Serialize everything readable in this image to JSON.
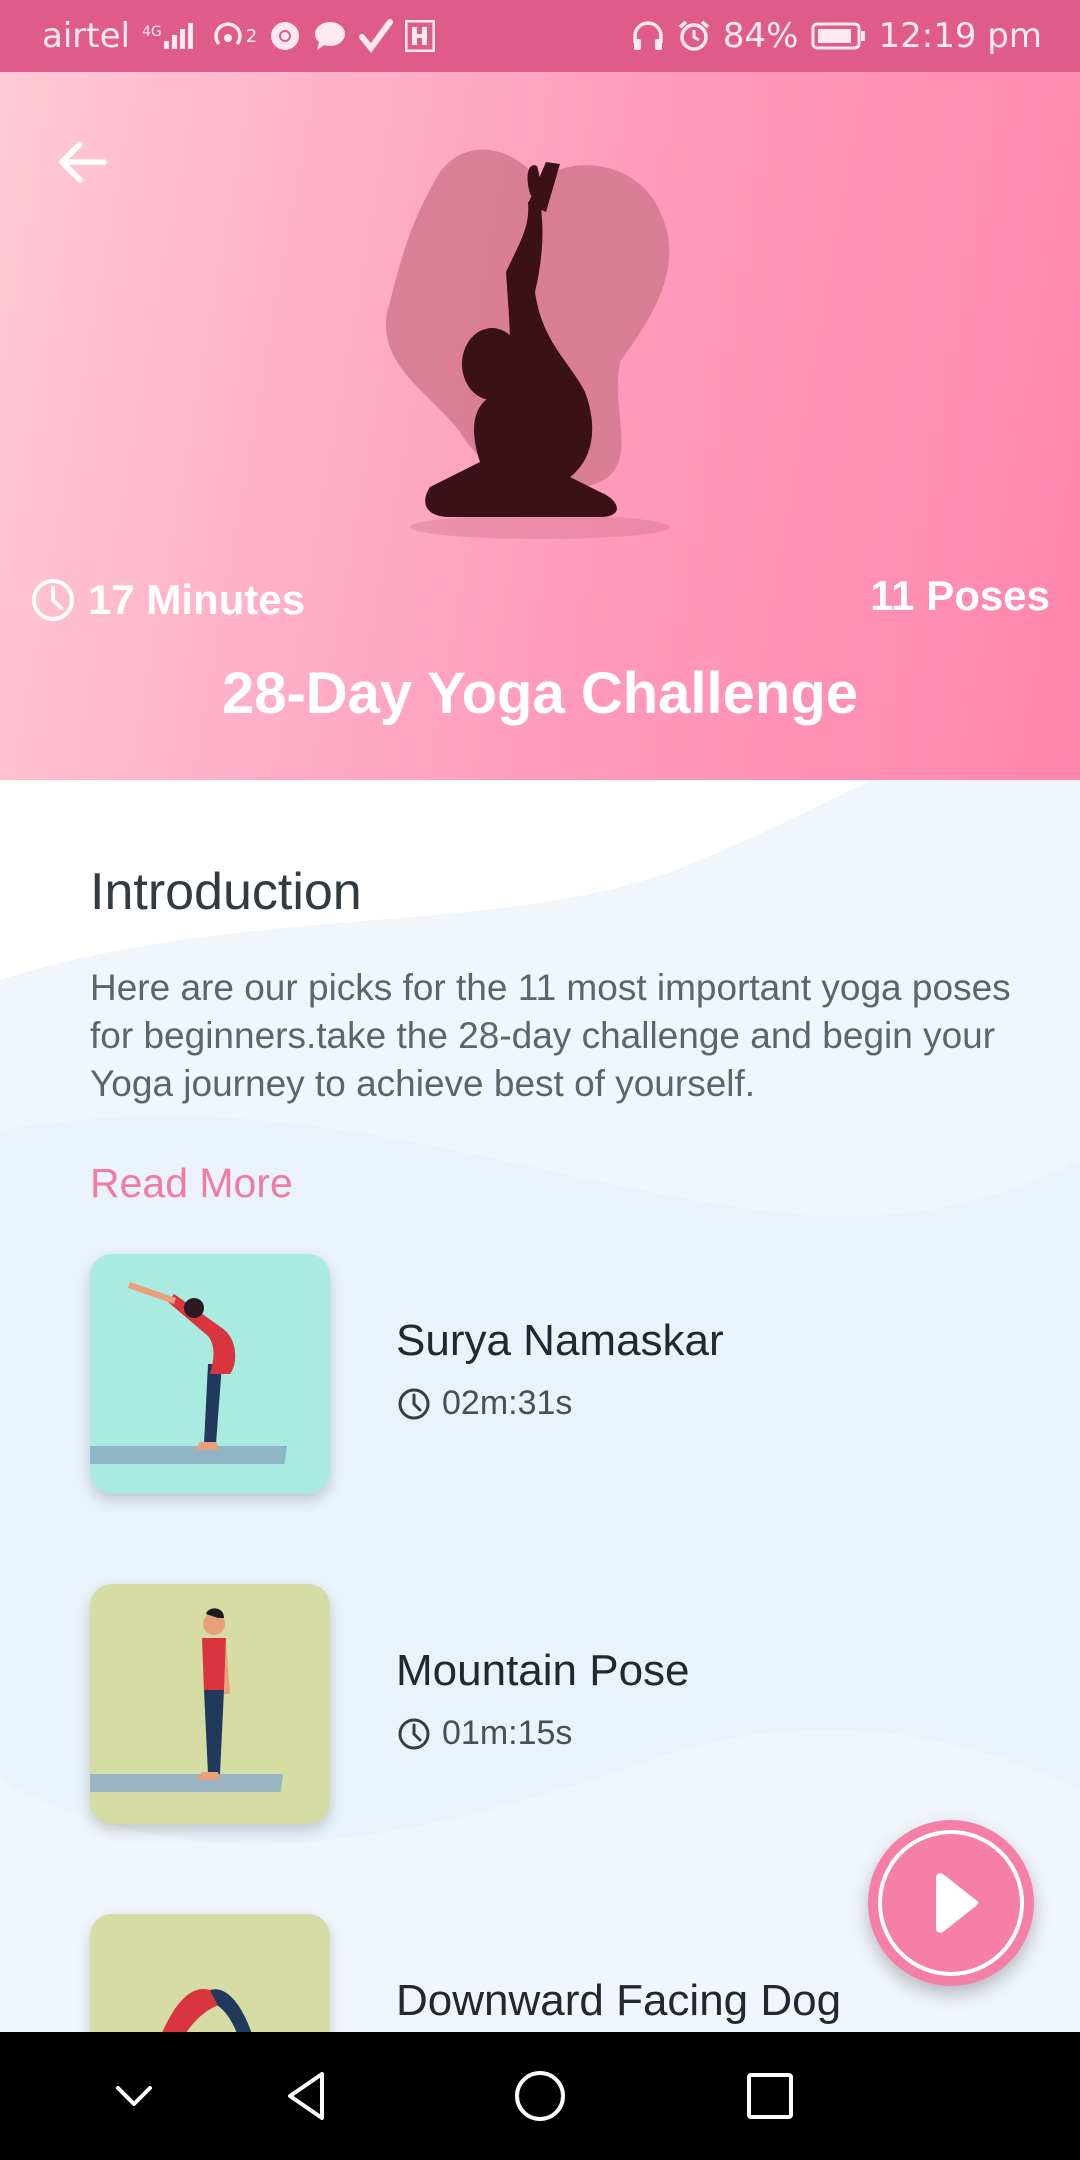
{
  "status_bar": {
    "carrier": "airtel",
    "network": "4G",
    "hotspot_count": "2",
    "battery": "84%",
    "time": "12:19 pm"
  },
  "header": {
    "duration": "17 Minutes",
    "poses": "11 Poses",
    "title": "28-Day Yoga Challenge",
    "gradient_colors": [
      "#ffc9d6",
      "#ff86ad"
    ]
  },
  "intro": {
    "heading": "Introduction",
    "text": "Here are our picks for the 11 most important yoga poses for beginners.take the 28-day challenge and begin your Yoga journey to achieve best of yourself.",
    "read_more": "Read More"
  },
  "poses": [
    {
      "name": "Surya Namaskar",
      "duration": "02m:31s",
      "thumb_color": "#a9ebe0"
    },
    {
      "name": "Mountain Pose",
      "duration": "01m:15s",
      "thumb_color": "#d5dca4"
    },
    {
      "name": "Downward Facing Dog",
      "duration": "",
      "thumb_color": "#d5dca4"
    }
  ],
  "colors": {
    "accent": "#f57fa6",
    "status_bar": "#df5c8a",
    "silhouette": "#3a1019"
  },
  "icons": {
    "back": "arrow-left-icon",
    "clock": "clock-icon",
    "play": "play-icon",
    "nav": [
      "chevron-down-icon",
      "back-triangle-icon",
      "home-circle-icon",
      "recents-square-icon"
    ]
  }
}
